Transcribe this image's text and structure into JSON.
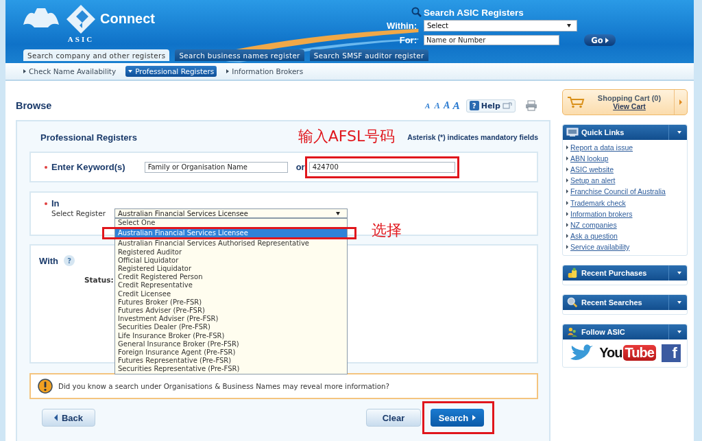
{
  "header": {
    "logo_text": "Connect",
    "logo_sub": "ASIC",
    "search": {
      "title": "Search ASIC Registers",
      "within_label": "Within:",
      "within_value": "Select",
      "for_label": "For:",
      "for_placeholder": "Name or Number",
      "go": "Go"
    },
    "tabs": [
      {
        "label": "Search company and other registers",
        "selected": true
      },
      {
        "label": "Search business names register",
        "selected": false
      },
      {
        "label": "Search SMSF auditor register",
        "selected": false
      }
    ]
  },
  "subnav": [
    {
      "label": "Check Name Availability",
      "selected": false
    },
    {
      "label": "Professional Registers",
      "selected": true
    },
    {
      "label": "Information Brokers",
      "selected": false
    }
  ],
  "page_title": "Browse",
  "font_sizes": [
    "A",
    "A",
    "A",
    "A"
  ],
  "help": {
    "icon": "?",
    "label": "Help"
  },
  "form": {
    "title": "Professional Registers",
    "note": "Asterisk (*) indicates mandatory fields",
    "keyword": {
      "label": "Enter Keyword(s)",
      "required": true,
      "name_placeholder": "Family or Organisation Name",
      "or": "or",
      "number_value": "424700",
      "number_highlighted": true,
      "annotation": "输入AFSL号码"
    },
    "register": {
      "label": "In",
      "required": true,
      "select_label": "Select Register",
      "value": "Australian Financial Services Licensee",
      "expanded": true,
      "annotation": "选择",
      "options": [
        {
          "label": "Select One",
          "selected": false,
          "highlighted": false
        },
        {
          "label": "Australian Financial Services Licensee",
          "selected": true,
          "highlighted": true
        },
        {
          "label": "Australian Financial Services Authorised Representative",
          "selected": false,
          "highlighted": false
        },
        {
          "label": "Registered Auditor",
          "selected": false,
          "highlighted": false
        },
        {
          "label": "Official Liquidator",
          "selected": false,
          "highlighted": false
        },
        {
          "label": "Registered Liquidator",
          "selected": false,
          "highlighted": false
        },
        {
          "label": "Credit Registered Person",
          "selected": false,
          "highlighted": false
        },
        {
          "label": "Credit Representative",
          "selected": false,
          "highlighted": false
        },
        {
          "label": "Credit Licensee",
          "selected": false,
          "highlighted": false
        },
        {
          "label": "Futures Broker (Pre-FSR)",
          "selected": false,
          "highlighted": false
        },
        {
          "label": "Futures Adviser (Pre-FSR)",
          "selected": false,
          "highlighted": false
        },
        {
          "label": "Investment Adviser (Pre-FSR)",
          "selected": false,
          "highlighted": false
        },
        {
          "label": "Securities Dealer (Pre-FSR)",
          "selected": false,
          "highlighted": false
        },
        {
          "label": "Life Insurance Broker (Pre-FSR)",
          "selected": false,
          "highlighted": false
        },
        {
          "label": "General Insurance Broker (Pre-FSR)",
          "selected": false,
          "highlighted": false
        },
        {
          "label": "Foreign Insurance Agent (Pre-FSR)",
          "selected": false,
          "highlighted": false
        },
        {
          "label": "Futures Representative (Pre-FSR)",
          "selected": false,
          "highlighted": false
        },
        {
          "label": "Securities Representative (Pre-FSR)",
          "selected": false,
          "highlighted": false
        }
      ]
    },
    "with": {
      "label": "With",
      "help_mark": "?",
      "status_label": "Status:"
    }
  },
  "notice": "Did you know a search under Organisations & Business Names may reveal more information?",
  "buttons": {
    "back": "Back",
    "clear": "Clear",
    "search": "Search",
    "search_highlighted": true
  },
  "sidebar": {
    "cart": {
      "title": "Shopping Cart (0)",
      "link": "View Cart"
    },
    "panels": [
      {
        "kind": "links",
        "title": "Quick Links",
        "links": [
          "Report a data issue",
          "ABN lookup",
          "ASIC website",
          "Setup an alert",
          "Franchise Council of Australia",
          "Trademark check",
          "Information brokers",
          "NZ companies",
          "Ask a question",
          "Service availability"
        ]
      },
      {
        "kind": "purchases",
        "title": "Recent Purchases"
      },
      {
        "kind": "searches",
        "title": "Recent Searches"
      },
      {
        "kind": "social",
        "title": "Follow ASIC",
        "youtube": [
          "You",
          "Tube"
        ],
        "facebook": "f"
      }
    ]
  }
}
